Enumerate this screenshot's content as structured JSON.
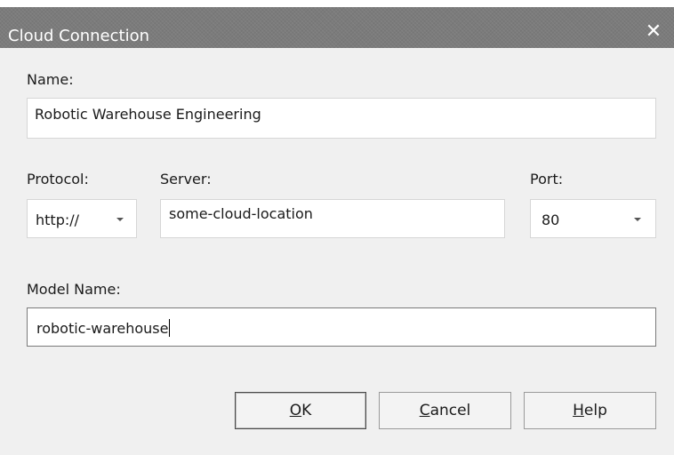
{
  "dialog": {
    "title": "Cloud Connection",
    "close_glyph": "✕"
  },
  "form": {
    "name_label": "Name:",
    "name_value": "Robotic Warehouse Engineering",
    "protocol_label": "Protocol:",
    "protocol_value": "http://",
    "server_label": "Server:",
    "server_value": "some-cloud-location",
    "port_label": "Port:",
    "port_value": "80",
    "model_name_label": "Model Name:",
    "model_name_value": "robotic-warehouse"
  },
  "buttons": {
    "ok_accel": "O",
    "ok_rest": "K",
    "cancel_accel": "C",
    "cancel_rest": "ancel",
    "help_accel": "H",
    "help_rest": "elp"
  },
  "icons": {
    "close": "close-icon",
    "dropdown": "chevron-down-icon"
  }
}
